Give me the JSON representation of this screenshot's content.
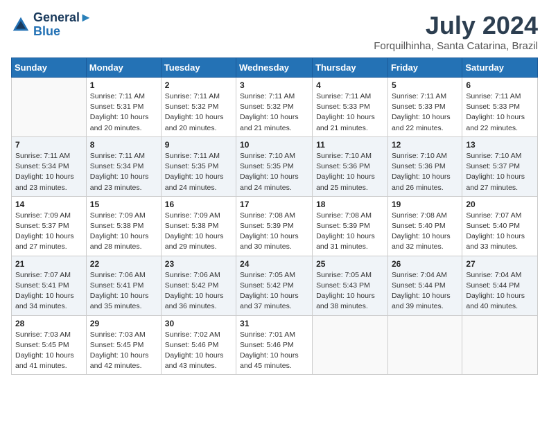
{
  "header": {
    "logo_line1": "General",
    "logo_line2": "Blue",
    "month": "July 2024",
    "location": "Forquilhinha, Santa Catarina, Brazil"
  },
  "days_of_week": [
    "Sunday",
    "Monday",
    "Tuesday",
    "Wednesday",
    "Thursday",
    "Friday",
    "Saturday"
  ],
  "weeks": [
    [
      {
        "num": "",
        "detail": ""
      },
      {
        "num": "1",
        "detail": "Sunrise: 7:11 AM\nSunset: 5:31 PM\nDaylight: 10 hours\nand 20 minutes."
      },
      {
        "num": "2",
        "detail": "Sunrise: 7:11 AM\nSunset: 5:32 PM\nDaylight: 10 hours\nand 20 minutes."
      },
      {
        "num": "3",
        "detail": "Sunrise: 7:11 AM\nSunset: 5:32 PM\nDaylight: 10 hours\nand 21 minutes."
      },
      {
        "num": "4",
        "detail": "Sunrise: 7:11 AM\nSunset: 5:33 PM\nDaylight: 10 hours\nand 21 minutes."
      },
      {
        "num": "5",
        "detail": "Sunrise: 7:11 AM\nSunset: 5:33 PM\nDaylight: 10 hours\nand 22 minutes."
      },
      {
        "num": "6",
        "detail": "Sunrise: 7:11 AM\nSunset: 5:33 PM\nDaylight: 10 hours\nand 22 minutes."
      }
    ],
    [
      {
        "num": "7",
        "detail": "Sunrise: 7:11 AM\nSunset: 5:34 PM\nDaylight: 10 hours\nand 23 minutes."
      },
      {
        "num": "8",
        "detail": "Sunrise: 7:11 AM\nSunset: 5:34 PM\nDaylight: 10 hours\nand 23 minutes."
      },
      {
        "num": "9",
        "detail": "Sunrise: 7:11 AM\nSunset: 5:35 PM\nDaylight: 10 hours\nand 24 minutes."
      },
      {
        "num": "10",
        "detail": "Sunrise: 7:10 AM\nSunset: 5:35 PM\nDaylight: 10 hours\nand 24 minutes."
      },
      {
        "num": "11",
        "detail": "Sunrise: 7:10 AM\nSunset: 5:36 PM\nDaylight: 10 hours\nand 25 minutes."
      },
      {
        "num": "12",
        "detail": "Sunrise: 7:10 AM\nSunset: 5:36 PM\nDaylight: 10 hours\nand 26 minutes."
      },
      {
        "num": "13",
        "detail": "Sunrise: 7:10 AM\nSunset: 5:37 PM\nDaylight: 10 hours\nand 27 minutes."
      }
    ],
    [
      {
        "num": "14",
        "detail": "Sunrise: 7:09 AM\nSunset: 5:37 PM\nDaylight: 10 hours\nand 27 minutes."
      },
      {
        "num": "15",
        "detail": "Sunrise: 7:09 AM\nSunset: 5:38 PM\nDaylight: 10 hours\nand 28 minutes."
      },
      {
        "num": "16",
        "detail": "Sunrise: 7:09 AM\nSunset: 5:38 PM\nDaylight: 10 hours\nand 29 minutes."
      },
      {
        "num": "17",
        "detail": "Sunrise: 7:08 AM\nSunset: 5:39 PM\nDaylight: 10 hours\nand 30 minutes."
      },
      {
        "num": "18",
        "detail": "Sunrise: 7:08 AM\nSunset: 5:39 PM\nDaylight: 10 hours\nand 31 minutes."
      },
      {
        "num": "19",
        "detail": "Sunrise: 7:08 AM\nSunset: 5:40 PM\nDaylight: 10 hours\nand 32 minutes."
      },
      {
        "num": "20",
        "detail": "Sunrise: 7:07 AM\nSunset: 5:40 PM\nDaylight: 10 hours\nand 33 minutes."
      }
    ],
    [
      {
        "num": "21",
        "detail": "Sunrise: 7:07 AM\nSunset: 5:41 PM\nDaylight: 10 hours\nand 34 minutes."
      },
      {
        "num": "22",
        "detail": "Sunrise: 7:06 AM\nSunset: 5:41 PM\nDaylight: 10 hours\nand 35 minutes."
      },
      {
        "num": "23",
        "detail": "Sunrise: 7:06 AM\nSunset: 5:42 PM\nDaylight: 10 hours\nand 36 minutes."
      },
      {
        "num": "24",
        "detail": "Sunrise: 7:05 AM\nSunset: 5:42 PM\nDaylight: 10 hours\nand 37 minutes."
      },
      {
        "num": "25",
        "detail": "Sunrise: 7:05 AM\nSunset: 5:43 PM\nDaylight: 10 hours\nand 38 minutes."
      },
      {
        "num": "26",
        "detail": "Sunrise: 7:04 AM\nSunset: 5:44 PM\nDaylight: 10 hours\nand 39 minutes."
      },
      {
        "num": "27",
        "detail": "Sunrise: 7:04 AM\nSunset: 5:44 PM\nDaylight: 10 hours\nand 40 minutes."
      }
    ],
    [
      {
        "num": "28",
        "detail": "Sunrise: 7:03 AM\nSunset: 5:45 PM\nDaylight: 10 hours\nand 41 minutes."
      },
      {
        "num": "29",
        "detail": "Sunrise: 7:03 AM\nSunset: 5:45 PM\nDaylight: 10 hours\nand 42 minutes."
      },
      {
        "num": "30",
        "detail": "Sunrise: 7:02 AM\nSunset: 5:46 PM\nDaylight: 10 hours\nand 43 minutes."
      },
      {
        "num": "31",
        "detail": "Sunrise: 7:01 AM\nSunset: 5:46 PM\nDaylight: 10 hours\nand 45 minutes."
      },
      {
        "num": "",
        "detail": ""
      },
      {
        "num": "",
        "detail": ""
      },
      {
        "num": "",
        "detail": ""
      }
    ]
  ]
}
